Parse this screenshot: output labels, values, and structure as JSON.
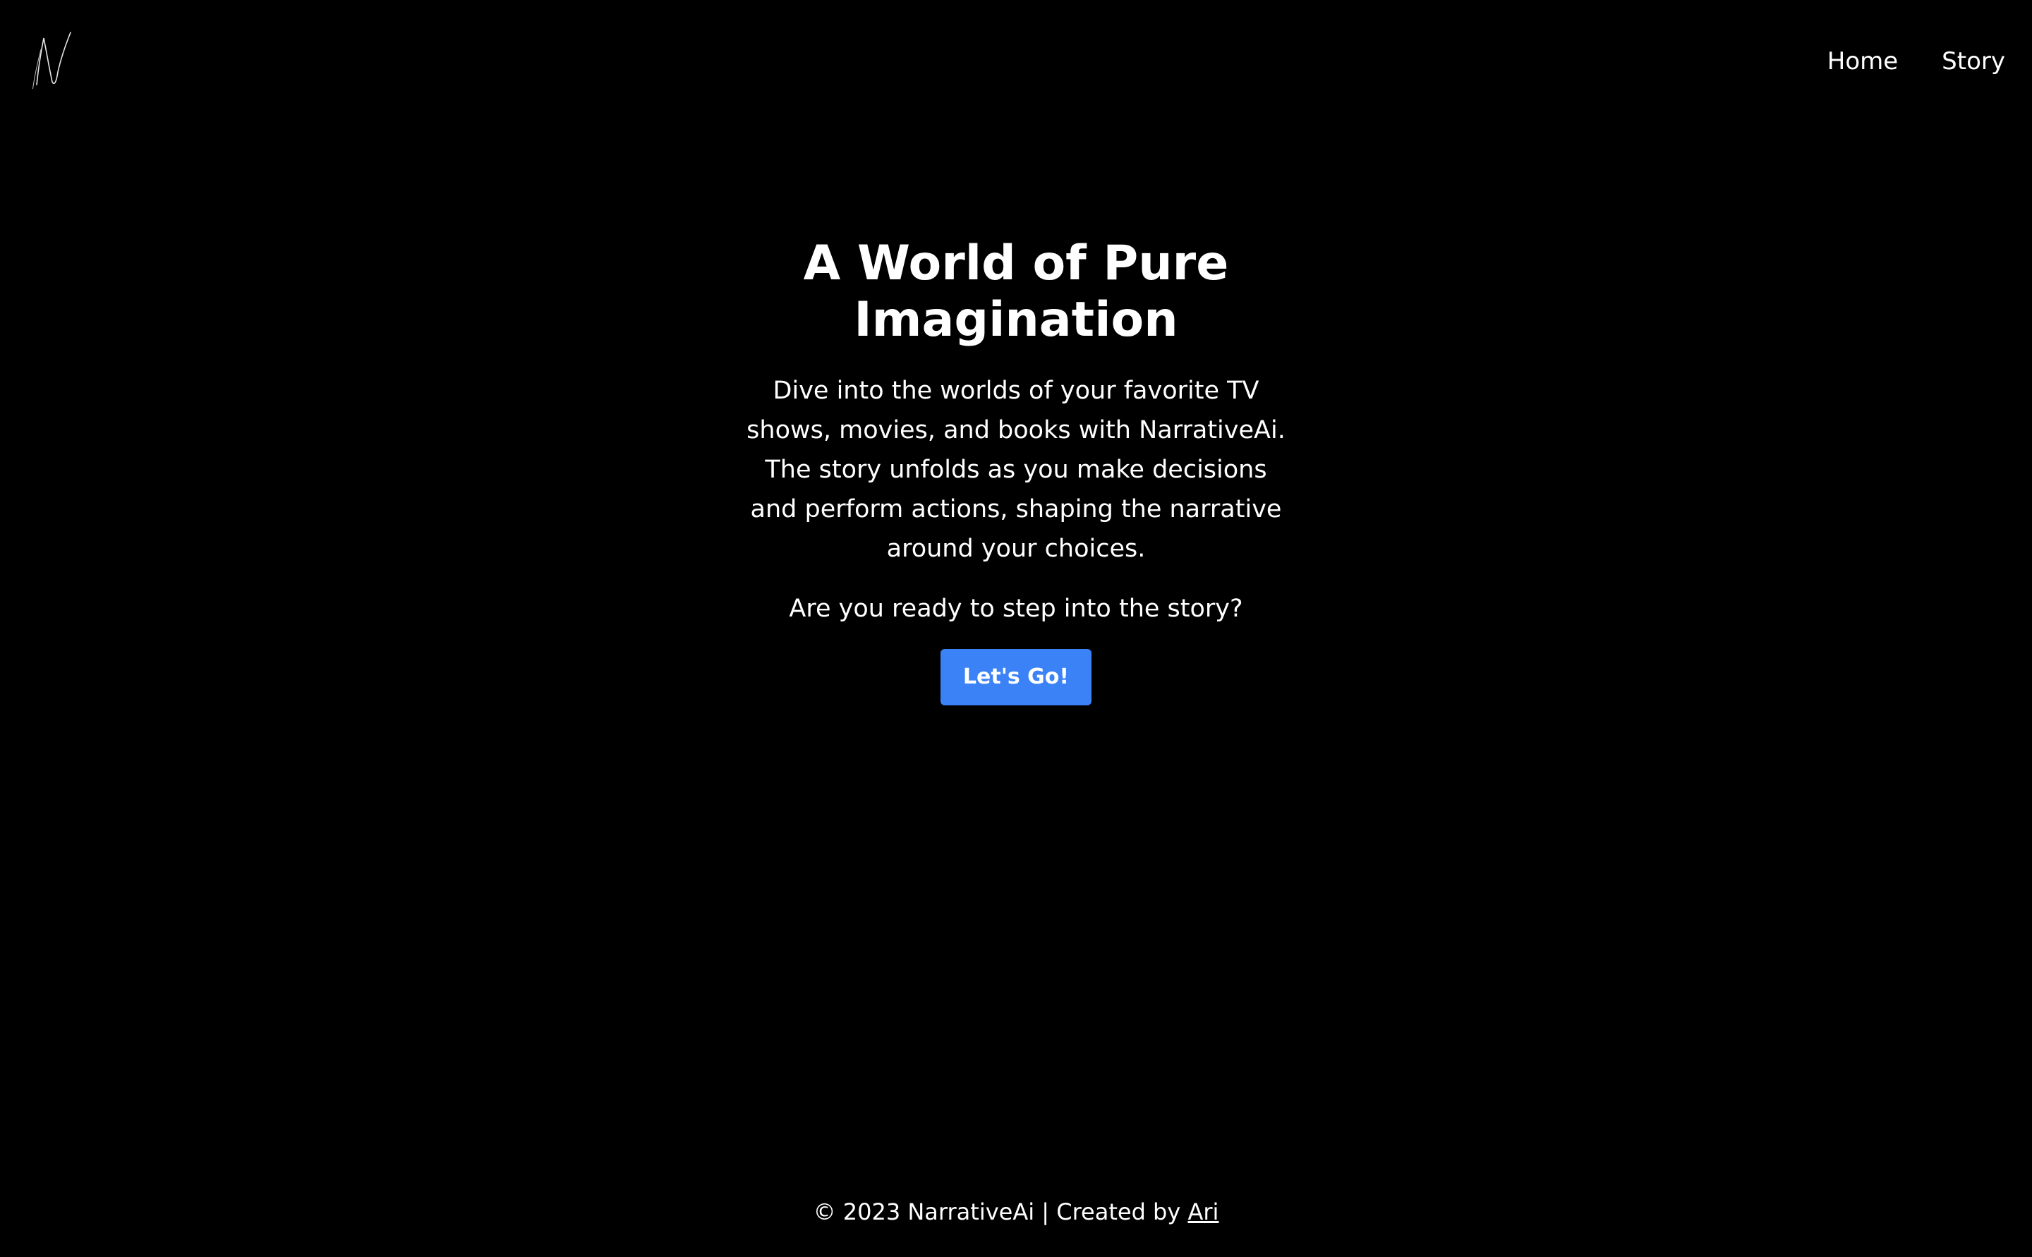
{
  "header": {
    "logo": {
      "icon": "narrativeai-script-n-logo",
      "letter": "N"
    },
    "nav": [
      {
        "label": "Home"
      },
      {
        "label": "Story"
      }
    ]
  },
  "hero": {
    "title": "A World of Pure Imagination",
    "description": "Dive into the worlds of your favorite TV shows, movies, and books with NarrativeAi. The story unfolds as you make decisions and perform actions, shaping the narrative around your choices.",
    "question": "Are you ready to step into the story?",
    "cta_label": "Let's Go!"
  },
  "footer": {
    "copyright": "© 2023 NarrativeAi | Created by",
    "author_link": "Ari"
  },
  "colors": {
    "background": "#000000",
    "text": "#ffffff",
    "accent": "#3b82f6"
  }
}
